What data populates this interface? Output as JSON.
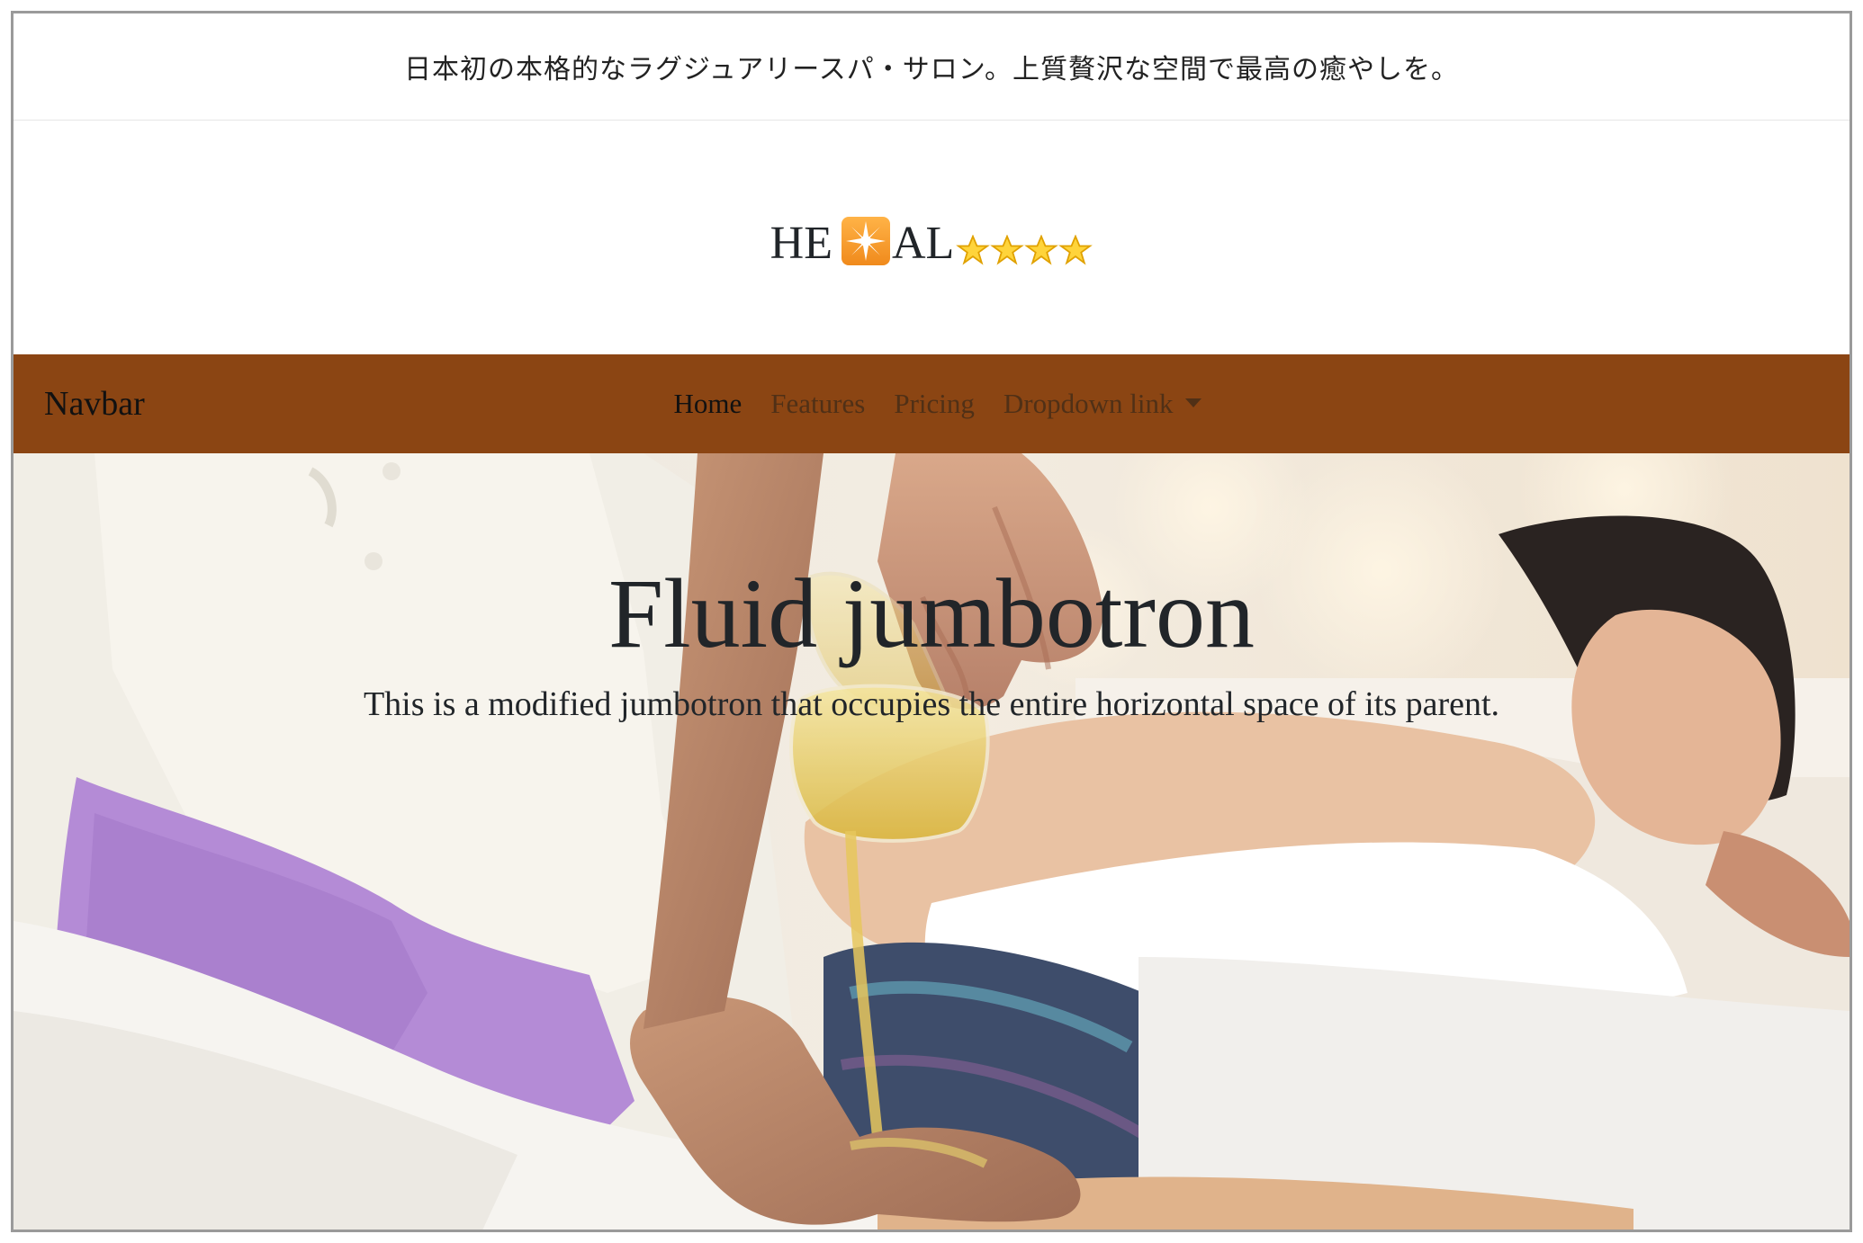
{
  "announcement": "日本初の本格的なラグジュアリースパ・サロン。上質贅沢な空間で最高の癒やしを。",
  "logo": {
    "part1": "HE",
    "part2": "AL",
    "icon": "sparkle-icon",
    "star_icon": "star-icon",
    "star_count": 4
  },
  "navbar": {
    "brand": "Navbar",
    "background": "#8b4513",
    "links": [
      {
        "label": "Home",
        "active": true
      },
      {
        "label": "Features",
        "active": false
      },
      {
        "label": "Pricing",
        "active": false
      },
      {
        "label": "Dropdown link",
        "active": false,
        "dropdown": true
      }
    ]
  },
  "hero": {
    "title": "Fluid jumbotron",
    "lead": "This is a modified jumbotron that occupies the entire horizontal space of its parent."
  }
}
